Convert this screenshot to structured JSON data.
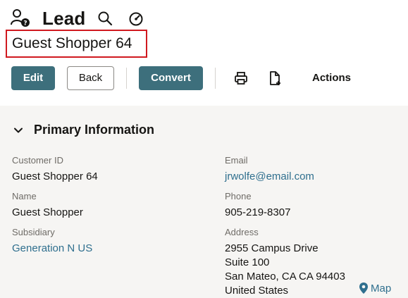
{
  "header": {
    "record_type": "Lead",
    "record_name": "Guest Shopper 64",
    "icons": [
      "lead-user-icon",
      "search-icon",
      "gauge-icon"
    ]
  },
  "toolbar": {
    "edit_label": "Edit",
    "back_label": "Back",
    "convert_label": "Convert",
    "actions_label": "Actions",
    "icons": [
      "print-icon",
      "new-document-icon"
    ]
  },
  "section": {
    "title": "Primary Information",
    "fields": {
      "customer_id": {
        "label": "Customer ID",
        "value": "Guest Shopper 64"
      },
      "name": {
        "label": "Name",
        "value": "Guest Shopper"
      },
      "subsidiary": {
        "label": "Subsidiary",
        "value": "Generation N US"
      },
      "email": {
        "label": "Email",
        "value": "jrwolfe@email.com"
      },
      "phone": {
        "label": "Phone",
        "value": "905-219-8307"
      },
      "address": {
        "label": "Address",
        "lines": [
          "2955 Campus Drive",
          "Suite 100",
          "San Mateo, CA CA 94403",
          "United States"
        ],
        "map_label": "Map"
      }
    }
  },
  "colors": {
    "primary_button": "#3d6f7c",
    "link": "#2f6f8e",
    "highlight_border": "#d0191f",
    "content_background": "#f6f5f3"
  }
}
